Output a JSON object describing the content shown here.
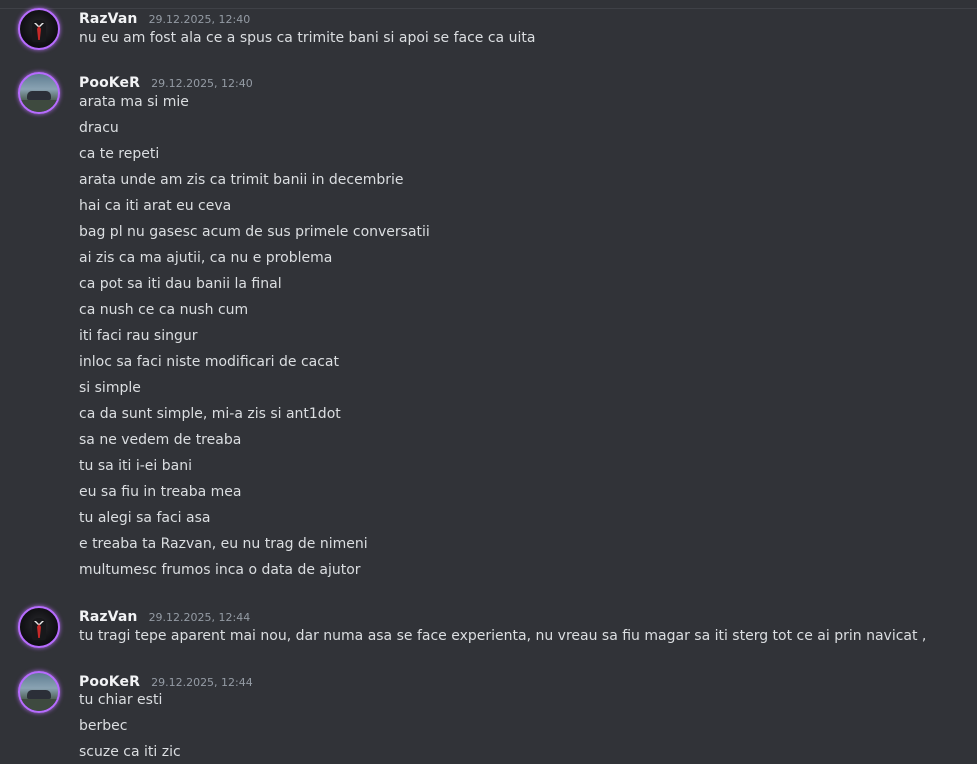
{
  "messages": [
    {
      "username": "RazVan",
      "timestamp": "29.12.2025, 12:40",
      "avatar": "razvan-avatar",
      "lines": [
        "nu eu am fost ala ce a spus ca trimite bani si apoi se face ca uita"
      ]
    },
    {
      "username": "PooKeR",
      "timestamp": "29.12.2025, 12:40",
      "avatar": "pooker-avatar",
      "lines": [
        "arata ma si mie",
        "dracu",
        "ca te repeti",
        "arata unde am zis ca trimit banii in decembrie",
        "hai ca iti arat eu ceva",
        "bag pl nu gasesc acum de sus primele conversatii",
        "ai zis ca ma ajutii, ca nu e problema",
        "ca pot sa iti dau banii la final",
        "ca nush ce ca nush cum",
        "iti faci rau singur",
        "inloc sa faci niste modificari de cacat",
        "si simple",
        "ca da sunt simple, mi-a zis si ant1dot",
        "sa ne vedem de treaba",
        "tu sa iti i-ei bani",
        "eu sa fiu in treaba mea",
        "tu alegi sa faci asa",
        "e treaba ta Razvan, eu nu trag de nimeni",
        "multumesc frumos inca o data de ajutor"
      ]
    },
    {
      "username": "RazVan",
      "timestamp": "29.12.2025, 12:44",
      "avatar": "razvan-avatar",
      "lines": [
        "tu tragi tepe aparent mai nou, dar numa asa se face experienta, nu vreau sa fiu magar sa iti sterg tot ce ai prin navicat ,"
      ]
    },
    {
      "username": "PooKeR",
      "timestamp": "29.12.2025, 12:44",
      "avatar": "pooker-avatar",
      "lines": [
        "tu chiar esti",
        "berbec",
        "scuze ca iti zic"
      ]
    }
  ]
}
